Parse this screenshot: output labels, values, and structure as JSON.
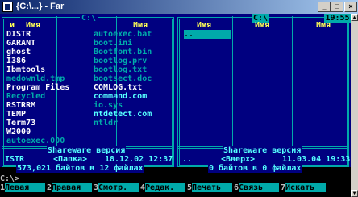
{
  "window": {
    "title": "{C:\\...} - Far"
  },
  "left_panel": {
    "path_title": "C:\\",
    "col_header_1": "и",
    "col_header_2": "Имя",
    "col_header_3": "Имя",
    "col1_items": [
      {
        "name": "DISTR",
        "style": "w"
      },
      {
        "name": "GARANT",
        "style": "w"
      },
      {
        "name": "ghost",
        "style": "w"
      },
      {
        "name": "I386",
        "style": "w"
      },
      {
        "name": "Ibmtools",
        "style": "w"
      },
      {
        "name": "medownld.tmp",
        "style": "d"
      },
      {
        "name": "Program Files",
        "style": "w"
      },
      {
        "name": "Recycled",
        "style": "d"
      },
      {
        "name": "RSTRRM",
        "style": "w"
      },
      {
        "name": "TEMP",
        "style": "w"
      },
      {
        "name": "Term73",
        "style": "w"
      },
      {
        "name": "W2000",
        "style": "w"
      },
      {
        "name": "autoexec.000",
        "style": "d"
      }
    ],
    "col2_items": [
      {
        "name": "autoexec.bat",
        "style": "d"
      },
      {
        "name": "boot.ini",
        "style": "d"
      },
      {
        "name": "Bootfont.bin",
        "style": "d"
      },
      {
        "name": "bootlog.prv",
        "style": "d"
      },
      {
        "name": "bootlog.txt",
        "style": "d"
      },
      {
        "name": "bootsect.doc",
        "style": "d"
      },
      {
        "name": "COMLOG.txt",
        "style": "w"
      },
      {
        "name": "command.com",
        "style": "c"
      },
      {
        "name": "io.sys",
        "style": "d"
      },
      {
        "name": "ntdetect.com",
        "style": "c"
      },
      {
        "name": "ntldr",
        "style": "d"
      }
    ],
    "footer_label": "Shareware версия",
    "info_name": "ISTR",
    "info_type": "<Папка>",
    "info_date": "18.12.02 12:37",
    "summary": "573,021 байтов в 12 файлах"
  },
  "right_panel": {
    "path_title": "C:\\",
    "col_header_1": "Имя",
    "col_header_2": "Имя",
    "col_header_3": "Имя",
    "col1_items": [
      {
        "name": "..",
        "style": "sel"
      }
    ],
    "footer_label": "Shareware версия",
    "info_name": "..",
    "info_type": "<Вверх>",
    "info_date": "11.03.04 19:33",
    "summary": "0 байтов в 0 файлах"
  },
  "clock": "19:55",
  "command_line": "C:\\>",
  "keybar": [
    {
      "num": "1",
      "label": "Левая"
    },
    {
      "num": "2",
      "label": "Правая"
    },
    {
      "num": "3",
      "label": "Смотр."
    },
    {
      "num": "4",
      "label": "Редак."
    },
    {
      "num": "5",
      "label": "Печать"
    },
    {
      "num": "6",
      "label": "Связь"
    },
    {
      "num": "7",
      "label": "Искать"
    }
  ],
  "colors": {
    "panel_bg": "#000080",
    "frame": "#00aaaa",
    "header_text": "#ffff55",
    "title_gradient_start": "#0a246a",
    "title_gradient_end": "#a6caf0"
  }
}
